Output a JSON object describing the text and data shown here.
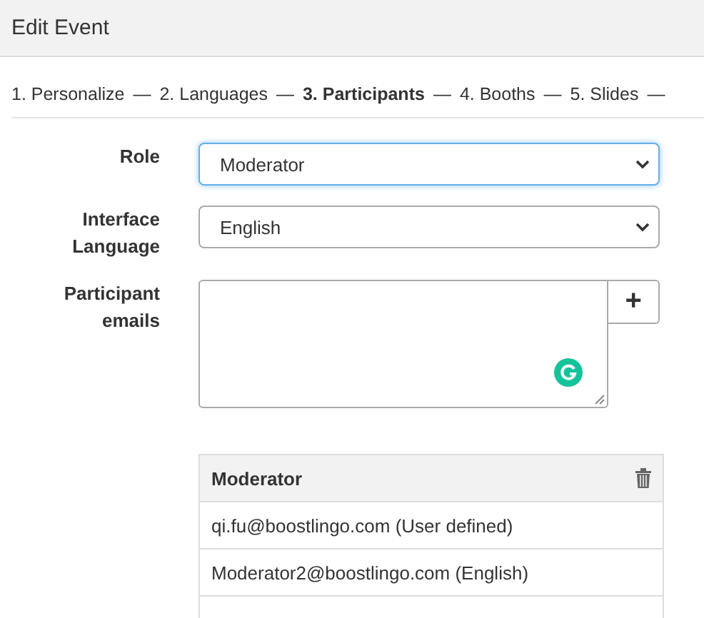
{
  "header": {
    "title": "Edit Event"
  },
  "steps": [
    {
      "kind": "step",
      "label": "1. Personalize",
      "selected": false
    },
    {
      "kind": "separator",
      "label": "—"
    },
    {
      "kind": "step",
      "label": "2. Languages",
      "selected": false
    },
    {
      "kind": "separator",
      "label": "—"
    },
    {
      "kind": "step",
      "label": "3. Participants",
      "selected": true
    },
    {
      "kind": "separator",
      "label": "—"
    },
    {
      "kind": "step",
      "label": "4. Booths",
      "selected": false
    },
    {
      "kind": "separator",
      "label": "—"
    },
    {
      "kind": "step",
      "label": "5. Slides",
      "selected": false
    },
    {
      "kind": "separator",
      "label": "—"
    }
  ],
  "form": {
    "role": {
      "label": "Role",
      "value": "Moderator",
      "focused": true
    },
    "language": {
      "label": "Interface Language",
      "value": "English",
      "focused": false
    },
    "emails": {
      "label": "Participant emails",
      "add_button": "+"
    }
  },
  "table": {
    "title": "Moderator",
    "rows": [
      {
        "text": "qi.fu@boostlingo.com (User defined)"
      },
      {
        "text": "Moderator2@boostlingo.com (English)"
      }
    ]
  }
}
